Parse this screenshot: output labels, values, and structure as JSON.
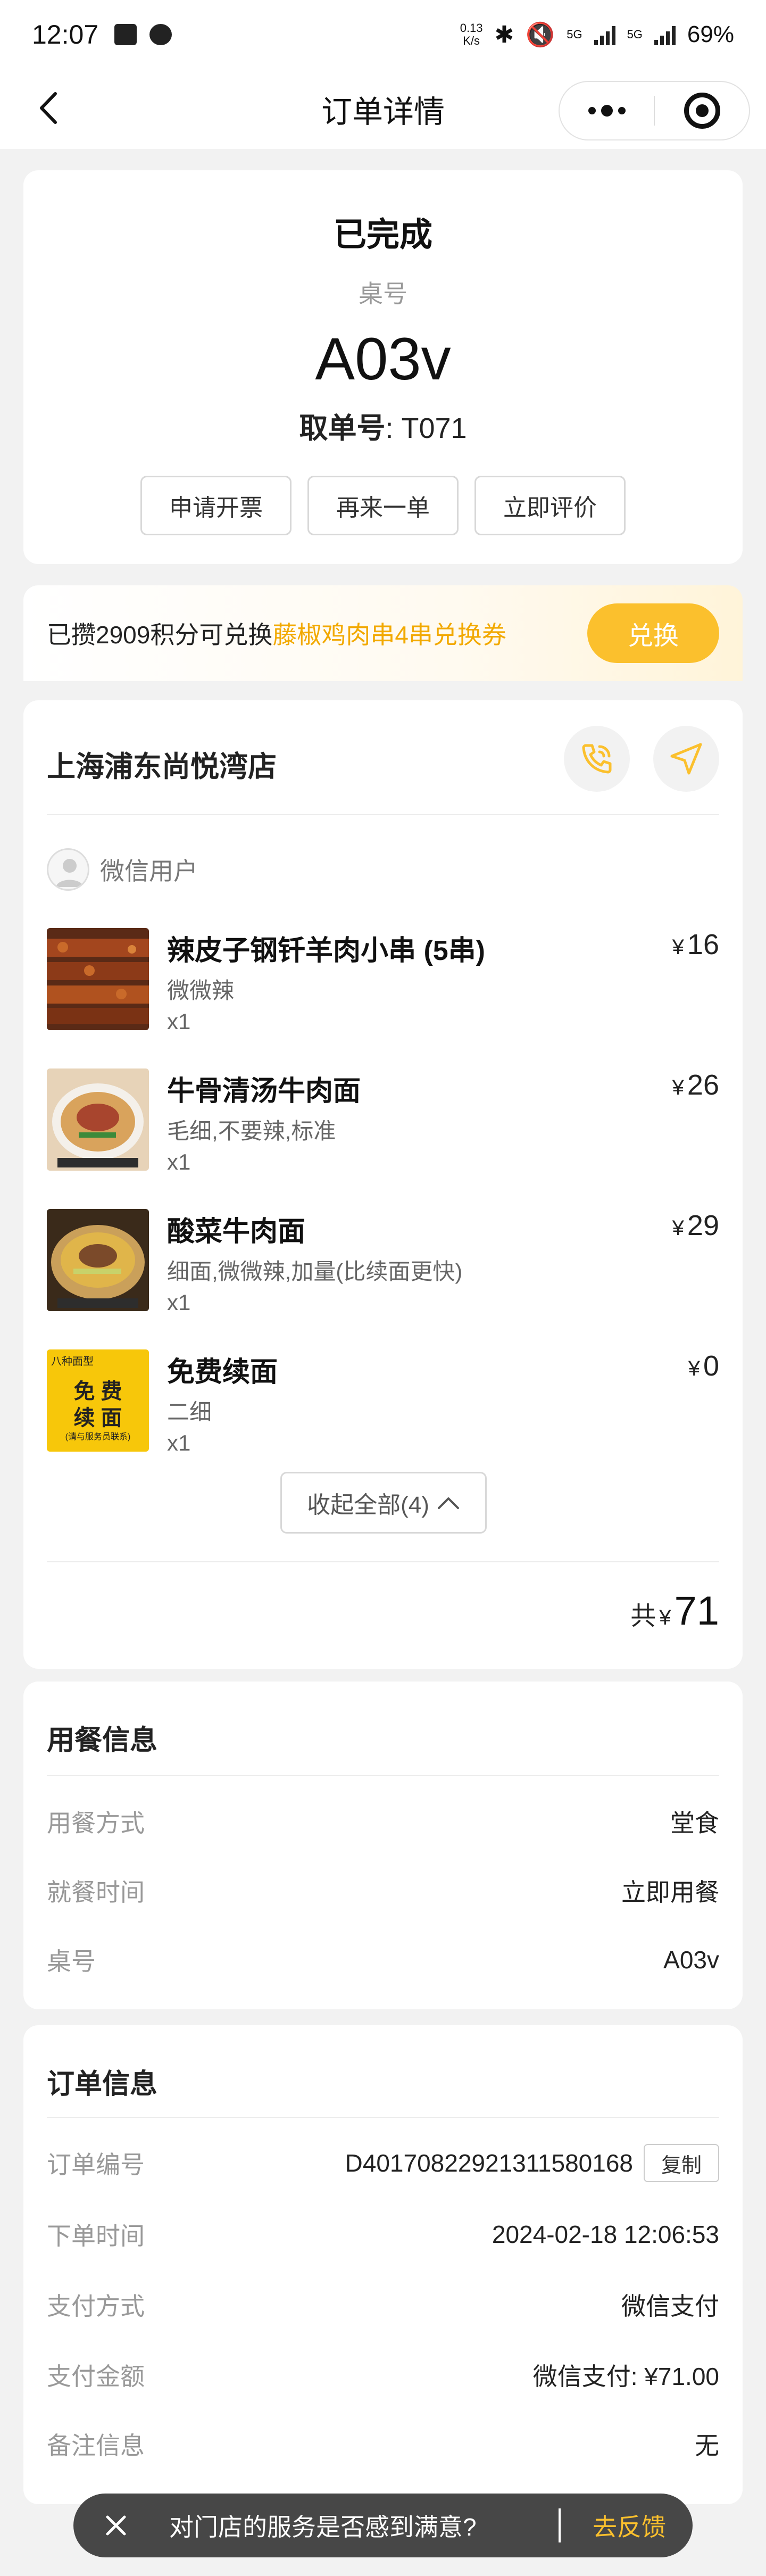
{
  "status_bar": {
    "time": "12:07",
    "net_speed_top": "0.13",
    "net_speed_bottom": "K/s",
    "sig1": "5G",
    "sig2": "5G",
    "battery": "69%"
  },
  "nav": {
    "title": "订单详情"
  },
  "status": {
    "title": "已完成",
    "table_label": "桌号",
    "table_no": "A03v",
    "pickup_label": "取单号",
    "pickup_value": ": T071",
    "buttons": [
      "申请开票",
      "再来一单",
      "立即评价"
    ]
  },
  "points": {
    "prefix": "已攒2909积分可兑换",
    "highlight": "藤椒鸡肉串4串兑换券",
    "button": "兑换"
  },
  "order": {
    "store": "上海浦东尚悦湾店",
    "user": "微信用户",
    "currency": "¥",
    "items": [
      {
        "name": "辣皮子钢钎羊肉小串 (5串)",
        "spec": "微微辣",
        "qty": "x1",
        "price": "16"
      },
      {
        "name": "牛骨清汤牛肉面",
        "spec": "毛细,不要辣,标准",
        "qty": "x1",
        "price": "26"
      },
      {
        "name": "酸菜牛肉面",
        "spec": "细面,微微辣,加量(比续面更快)",
        "qty": "x1",
        "price": "29"
      },
      {
        "name": "免费续面",
        "spec": "二细",
        "qty": "x1",
        "price": "0"
      }
    ],
    "free_noodle_image_text": [
      "八种面型",
      "免 费",
      "续 面",
      "(请与服务员联系)"
    ],
    "collapse_label": "收起全部(4)",
    "total_label": "共",
    "total_amount": "71"
  },
  "dining": {
    "title": "用餐信息",
    "rows": [
      {
        "label": "用餐方式",
        "value": "堂食"
      },
      {
        "label": "就餐时间",
        "value": "立即用餐"
      },
      {
        "label": "桌号",
        "value": "A03v"
      }
    ]
  },
  "order_info": {
    "title": "订单信息",
    "copy_label": "复制",
    "rows": [
      {
        "label": "订单编号",
        "value": "D40170822921311580168"
      },
      {
        "label": "下单时间",
        "value": "2024-02-18 12:06:53"
      },
      {
        "label": "支付方式",
        "value": "微信支付"
      },
      {
        "label": "支付金额",
        "value": "微信支付: ¥71.00"
      },
      {
        "label": "备注信息",
        "value": "无"
      }
    ]
  },
  "toast": {
    "text": "对门店的服务是否感到满意?",
    "link": "去反馈"
  },
  "colors": {
    "accent": "#fbc02d",
    "highlight_text": "#f2a900",
    "background": "#f2f2f2",
    "toast_bg": "#474747"
  }
}
